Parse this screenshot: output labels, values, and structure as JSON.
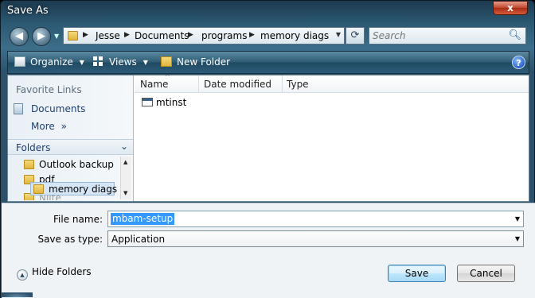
{
  "window": {
    "title": "Save As",
    "close_glyph": "x"
  },
  "nav": {
    "back_glyph": "◀",
    "forward_glyph": "▶",
    "dropdown_glyph": "▼"
  },
  "address": {
    "crumbs": [
      "Jesse",
      "Documents",
      "programs",
      "memory diags"
    ],
    "separator": "▶",
    "dropdown_glyph": "▼",
    "refresh_glyph": "⟳"
  },
  "search": {
    "placeholder": "Search",
    "icon": "magnifier-icon"
  },
  "toolbar": {
    "organize_label": "Organize",
    "views_label": "Views",
    "new_folder_label": "New Folder",
    "dropdown_glyph": "▼",
    "help_glyph": "?"
  },
  "left_pane": {
    "favorites_heading": "Favorite Links",
    "favorites": [
      {
        "label": "Documents",
        "icon": "documents-icon"
      }
    ],
    "more_label": "More",
    "more_glyph": "»",
    "folders_label": "Folders",
    "folders_chevron": "⌄",
    "tree": [
      "Outlook backup",
      "pdf",
      "memory diags",
      "Nlite"
    ]
  },
  "file_list": {
    "columns": [
      "Name",
      "Date modified",
      "Type"
    ],
    "sort_glyph": "^",
    "files": [
      {
        "name": "mtinst",
        "icon": "application-file-icon"
      }
    ]
  },
  "form": {
    "file_name_label": "File name:",
    "file_name_value": "mbam-setup",
    "save_type_label": "Save as type:",
    "save_type_value": "Application",
    "dropdown_glyph": "▼"
  },
  "footer": {
    "hide_folders_label": "Hide Folders",
    "hide_folders_glyph": "▲",
    "save_label": "Save",
    "cancel_label": "Cancel"
  },
  "colors": {
    "accent": "#2c5169",
    "selection": "#3399ff",
    "close": "#c0452d"
  }
}
